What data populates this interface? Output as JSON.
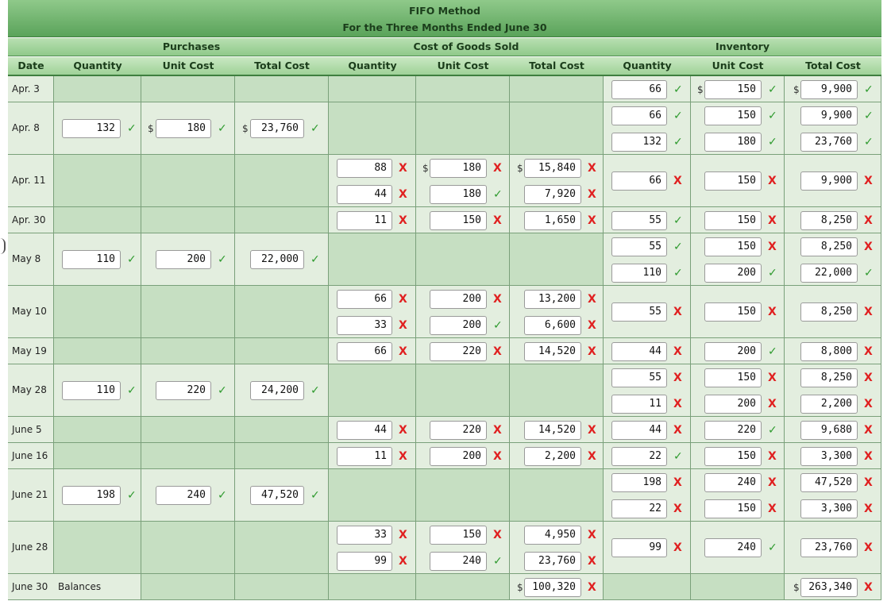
{
  "title": "FIFO Method",
  "subtitle": "For the Three Months Ended June 30",
  "groups": {
    "purchases": "Purchases",
    "cogs": "Cost of Goods Sold",
    "inventory": "Inventory"
  },
  "headers": [
    "Date",
    "Quantity",
    "Unit Cost",
    "Total Cost",
    "Quantity",
    "Unit Cost",
    "Total Cost",
    "Quantity",
    "Unit Cost",
    "Total Cost"
  ],
  "rows": [
    {
      "date": "Apr. 3",
      "inv": [
        {
          "q": "66",
          "qm": "ok",
          "u": "150",
          "um": "ok",
          "t": "9,900",
          "tm": "ok",
          "dollar": true
        }
      ]
    },
    {
      "date": "Apr. 8",
      "purch": {
        "q": "132",
        "qm": "ok",
        "u": "180",
        "um": "ok",
        "t": "23,760",
        "tm": "ok",
        "dollar": true
      },
      "inv": [
        {
          "q": "66",
          "qm": "ok",
          "u": "150",
          "um": "ok",
          "t": "9,900",
          "tm": "ok"
        },
        {
          "q": "132",
          "qm": "ok",
          "u": "180",
          "um": "ok",
          "t": "23,760",
          "tm": "ok"
        }
      ]
    },
    {
      "date": "Apr. 11",
      "cogs": [
        {
          "q": "88",
          "qm": "bad",
          "u": "180",
          "um": "bad",
          "t": "15,840",
          "tm": "bad",
          "dollar": true
        },
        {
          "q": "44",
          "qm": "bad",
          "u": "180",
          "um": "ok",
          "t": "7,920",
          "tm": "bad"
        }
      ],
      "inv": [
        {
          "q": "66",
          "qm": "bad",
          "u": "150",
          "um": "bad",
          "t": "9,900",
          "tm": "bad"
        }
      ]
    },
    {
      "date": "Apr. 30",
      "cogs": [
        {
          "q": "11",
          "qm": "bad",
          "u": "150",
          "um": "bad",
          "t": "1,650",
          "tm": "bad"
        }
      ],
      "inv": [
        {
          "q": "55",
          "qm": "ok",
          "u": "150",
          "um": "bad",
          "t": "8,250",
          "tm": "bad"
        }
      ]
    },
    {
      "date": "May 8",
      "purch": {
        "q": "110",
        "qm": "ok",
        "u": "200",
        "um": "ok",
        "t": "22,000",
        "tm": "ok"
      },
      "inv": [
        {
          "q": "55",
          "qm": "ok",
          "u": "150",
          "um": "bad",
          "t": "8,250",
          "tm": "bad"
        },
        {
          "q": "110",
          "qm": "ok",
          "u": "200",
          "um": "ok",
          "t": "22,000",
          "tm": "ok"
        }
      ]
    },
    {
      "date": "May 10",
      "cogs": [
        {
          "q": "66",
          "qm": "bad",
          "u": "200",
          "um": "bad",
          "t": "13,200",
          "tm": "bad"
        },
        {
          "q": "33",
          "qm": "bad",
          "u": "200",
          "um": "ok",
          "t": "6,600",
          "tm": "bad"
        }
      ],
      "inv": [
        {
          "q": "55",
          "qm": "bad",
          "u": "150",
          "um": "bad",
          "t": "8,250",
          "tm": "bad"
        }
      ]
    },
    {
      "date": "May 19",
      "cogs": [
        {
          "q": "66",
          "qm": "bad",
          "u": "220",
          "um": "bad",
          "t": "14,520",
          "tm": "bad"
        }
      ],
      "inv": [
        {
          "q": "44",
          "qm": "bad",
          "u": "200",
          "um": "ok",
          "t": "8,800",
          "tm": "bad"
        }
      ]
    },
    {
      "date": "May 28",
      "purch": {
        "q": "110",
        "qm": "ok",
        "u": "220",
        "um": "ok",
        "t": "24,200",
        "tm": "ok"
      },
      "inv": [
        {
          "q": "55",
          "qm": "bad",
          "u": "150",
          "um": "bad",
          "t": "8,250",
          "tm": "bad"
        },
        {
          "q": "11",
          "qm": "bad",
          "u": "200",
          "um": "bad",
          "t": "2,200",
          "tm": "bad"
        }
      ]
    },
    {
      "date": "June 5",
      "cogs": [
        {
          "q": "44",
          "qm": "bad",
          "u": "220",
          "um": "bad",
          "t": "14,520",
          "tm": "bad"
        }
      ],
      "inv": [
        {
          "q": "44",
          "qm": "bad",
          "u": "220",
          "um": "ok",
          "t": "9,680",
          "tm": "bad"
        }
      ]
    },
    {
      "date": "June 16",
      "cogs": [
        {
          "q": "11",
          "qm": "bad",
          "u": "200",
          "um": "bad",
          "t": "2,200",
          "tm": "bad"
        }
      ],
      "inv": [
        {
          "q": "22",
          "qm": "ok",
          "u": "150",
          "um": "bad",
          "t": "3,300",
          "tm": "bad"
        }
      ]
    },
    {
      "date": "June 21",
      "purch": {
        "q": "198",
        "qm": "ok",
        "u": "240",
        "um": "ok",
        "t": "47,520",
        "tm": "ok"
      },
      "inv": [
        {
          "q": "198",
          "qm": "bad",
          "u": "240",
          "um": "bad",
          "t": "47,520",
          "tm": "bad"
        },
        {
          "q": "22",
          "qm": "bad",
          "u": "150",
          "um": "bad",
          "t": "3,300",
          "tm": "bad"
        }
      ]
    },
    {
      "date": "June 28",
      "cogs": [
        {
          "q": "33",
          "qm": "bad",
          "u": "150",
          "um": "bad",
          "t": "4,950",
          "tm": "bad"
        },
        {
          "q": "99",
          "qm": "bad",
          "u": "240",
          "um": "ok",
          "t": "23,760",
          "tm": "bad"
        }
      ],
      "inv": [
        {
          "q": "99",
          "qm": "bad",
          "u": "240",
          "um": "ok",
          "t": "23,760",
          "tm": "bad"
        }
      ]
    },
    {
      "date": "June 30",
      "balances_label": "Balances",
      "cogs_total": {
        "t": "100,320",
        "tm": "bad"
      },
      "inv_total": {
        "t": "263,340",
        "tm": "bad"
      }
    }
  ],
  "marks": {
    "ok": "✓",
    "bad": "X"
  },
  "dollar_sign": "$"
}
